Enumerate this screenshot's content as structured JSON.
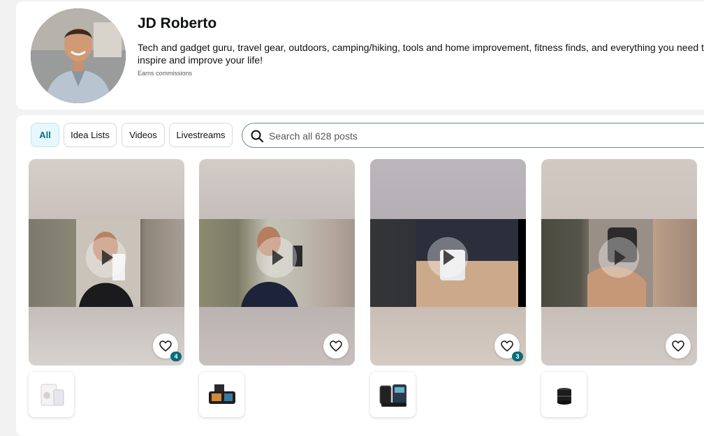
{
  "profile": {
    "name": "JD Roberto",
    "bio": "Tech and gadget guru, travel gear, outdoors, camping/hiking, tools and home improvement, fitness finds, and everything you need to inspire and improve your life!",
    "earns": "Earns commissions"
  },
  "filters": {
    "all": "All",
    "idea_lists": "Idea Lists",
    "videos": "Videos",
    "livestreams": "Livestreams"
  },
  "search": {
    "placeholder": "Search all 628 posts"
  },
  "posts": [
    {
      "badge": "4",
      "icon": "play-icon",
      "product": "white-device-product"
    },
    {
      "badge": "",
      "icon": "play-icon",
      "product": "dashcam-product"
    },
    {
      "badge": "3",
      "icon": "play-icon",
      "product": "charging-stand-product"
    },
    {
      "badge": "",
      "icon": "play-icon",
      "product": "black-cylinder-product"
    }
  ],
  "colors": {
    "accent": "#007185",
    "badge": "#0a6a7a",
    "active_filter_bg": "#e8f7fb"
  }
}
